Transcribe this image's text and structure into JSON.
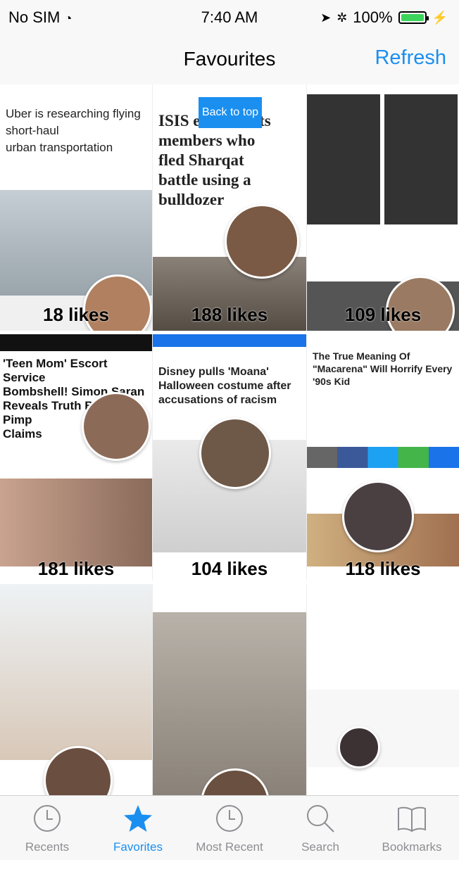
{
  "status_bar": {
    "carrier": "No SIM",
    "time": "7:40 AM",
    "battery": "100%",
    "battery_level": 1.0
  },
  "nav": {
    "title": "Favourites",
    "refresh": "Refresh"
  },
  "back_to_top": "Back to top",
  "tiles": [
    {
      "likes": "18 likes",
      "lines": [
        "Uber is researching flying",
        "short-haul",
        "urban transportation"
      ]
    },
    {
      "likes": "188 likes",
      "lines": [
        "ISIS executes its",
        "members who",
        "fled Sharqat",
        "battle using a",
        "bulldozer"
      ]
    },
    {
      "likes": "109 likes",
      "lines": []
    },
    {
      "likes": "181 likes",
      "lines": [
        "'Teen Mom' Escort Service",
        "Bombshell! Simon Saran",
        "Reveals Truth Behind Pimp",
        "Claims"
      ]
    },
    {
      "likes": "104 likes",
      "lines": [
        "Disney pulls 'Moana'",
        "Halloween costume after",
        "accusations of racism"
      ]
    },
    {
      "likes": "118 likes",
      "lines": [
        "The True Meaning Of",
        "\"Macarena\" Will Horrify Every",
        "'90s Kid"
      ]
    },
    {
      "likes": "",
      "lines": []
    },
    {
      "likes": "",
      "lines": []
    },
    {
      "likes": "",
      "lines": []
    }
  ],
  "tab_bar": {
    "items": [
      {
        "label": "Recents",
        "icon": "clock-icon"
      },
      {
        "label": "Favorites",
        "icon": "star-icon",
        "active": true
      },
      {
        "label": "Most Recent",
        "icon": "clock-icon"
      },
      {
        "label": "Search",
        "icon": "search-icon"
      },
      {
        "label": "Bookmarks",
        "icon": "book-icon"
      }
    ]
  },
  "colors": {
    "accent": "#1a8ff0",
    "tab_inactive": "#8e8e93"
  }
}
